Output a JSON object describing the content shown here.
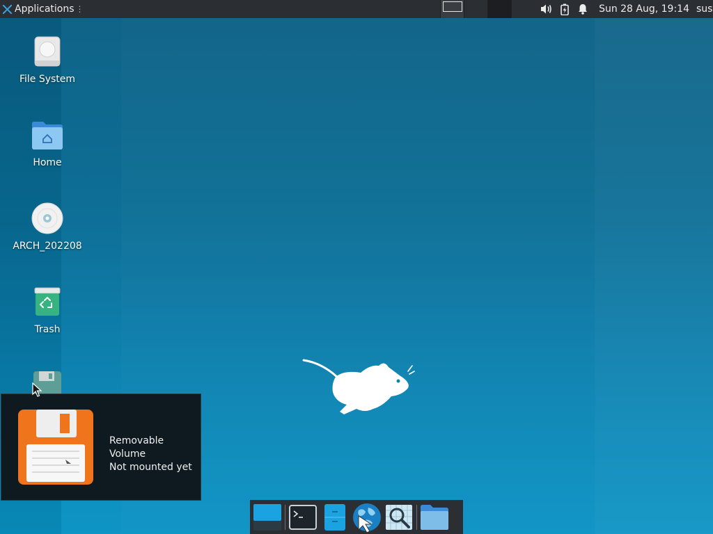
{
  "panel": {
    "apps_label": "Applications",
    "handle_glyph": "⋮",
    "clock": "Sun 28 Aug, 19:14",
    "user": "sus"
  },
  "desktop": {
    "icons": [
      {
        "label": "File System",
        "icon": "drive-harddisk-icon"
      },
      {
        "label": "Home",
        "icon": "home-folder-icon"
      },
      {
        "label": "ARCH_202208",
        "icon": "optical-disc-icon"
      },
      {
        "label": "Trash",
        "icon": "trash-icon"
      },
      {
        "label": "",
        "icon": "floppy-disk-icon"
      }
    ]
  },
  "notification": {
    "title": "Removable Volume",
    "body": "Not mounted yet",
    "icon": "floppy-disk-icon"
  },
  "dock": {
    "items": [
      {
        "name": "show-desktop",
        "icon": "show-desktop-icon"
      },
      {
        "name": "terminal",
        "icon": "terminal-icon"
      },
      {
        "name": "file-manager",
        "icon": "file-manager-icon"
      },
      {
        "name": "web-browser",
        "icon": "web-browser-icon"
      },
      {
        "name": "app-finder",
        "icon": "app-finder-icon"
      },
      {
        "name": "folder",
        "icon": "folder-icon"
      }
    ]
  },
  "colors": {
    "panel_bg": "#2b2e33",
    "desktop_top": "#0b5f84",
    "desktop_bottom": "#0a93c4",
    "notification_bg": "#0e1a1f",
    "floppy_orange": "#f0741c"
  }
}
